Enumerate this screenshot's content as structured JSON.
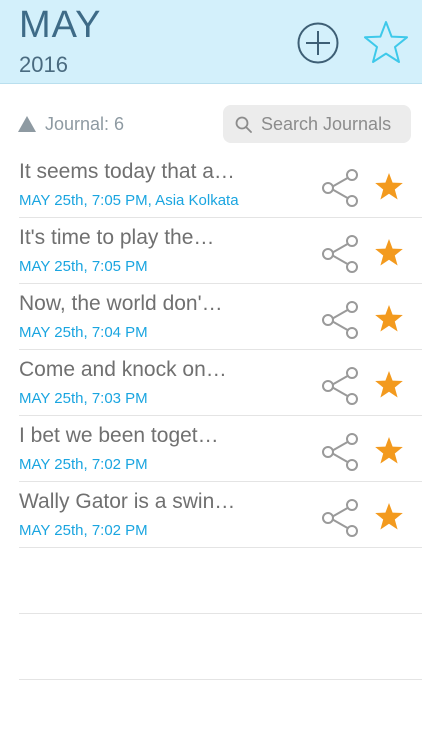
{
  "header": {
    "month": "MAY",
    "year": "2016",
    "icons": {
      "add": "plus-circle-icon",
      "favorites": "star-outline-icon"
    },
    "colors": {
      "background": "#d3f0fb",
      "month": "#3e6b87",
      "star_outline": "#3ec9ea"
    }
  },
  "toolbar": {
    "journal_count": "Journal: 6",
    "search_placeholder": "Search Journals",
    "icons": {
      "sort": "triangle-up-icon",
      "search": "magnifier-icon"
    }
  },
  "entries": [
    {
      "title": "It seems today that a…",
      "date": "MAY 25th, 7:05 PM, Asia Kolkata",
      "starred": true
    },
    {
      "title": "It's time to play the…",
      "date": "MAY 25th, 7:05 PM",
      "starred": true
    },
    {
      "title": "Now, the world don'…",
      "date": "MAY 25th, 7:04 PM",
      "starred": true
    },
    {
      "title": "Come and knock on…",
      "date": "MAY 25th, 7:03 PM",
      "starred": true
    },
    {
      "title": "I bet we been toget…",
      "date": "MAY 25th, 7:02 PM",
      "starred": true
    },
    {
      "title": "Wally Gator is a swin…",
      "date": "MAY 25th, 7:02 PM",
      "starred": true
    }
  ],
  "row_icons": {
    "share": "share-icon",
    "favorite": "star-filled-icon"
  },
  "colors": {
    "date_text": "#1aa5e0",
    "star_filled": "#f39a1e",
    "share_icon": "#9a9a9a"
  }
}
